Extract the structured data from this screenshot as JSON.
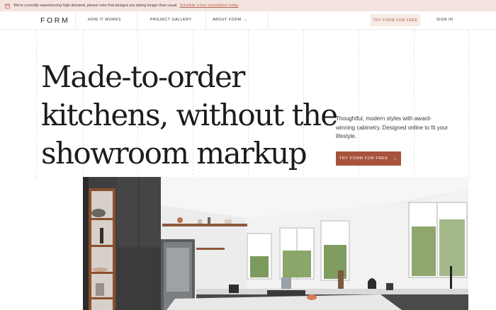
{
  "banner": {
    "message": "We're currently experiencing high demand, please note that designs are taking longer than usual.",
    "link": "Schedule a free consultation today",
    "icon": "calendar-icon"
  },
  "nav": {
    "logo": "FORM",
    "items": [
      "HOW IT WORKS",
      "PROJECT GALLERY",
      "ABOUT FORM"
    ],
    "try_button": "TRY FORM FOR FREE",
    "sign_in": "SIGN IN"
  },
  "hero": {
    "headline": [
      "Made-to-order",
      "kitchens, without the",
      "showroom markup"
    ],
    "subtext": "Thoughtful, modern styles with award-winning cabinetry. Designed online to fit your lifestyle.",
    "cta_label": "TRY FORM FOR FREE",
    "cta_arrow": "→"
  },
  "colors": {
    "accent": "#a8533d",
    "banner_bg": "#f4e4e0",
    "try_bg": "#f7ebe5"
  }
}
